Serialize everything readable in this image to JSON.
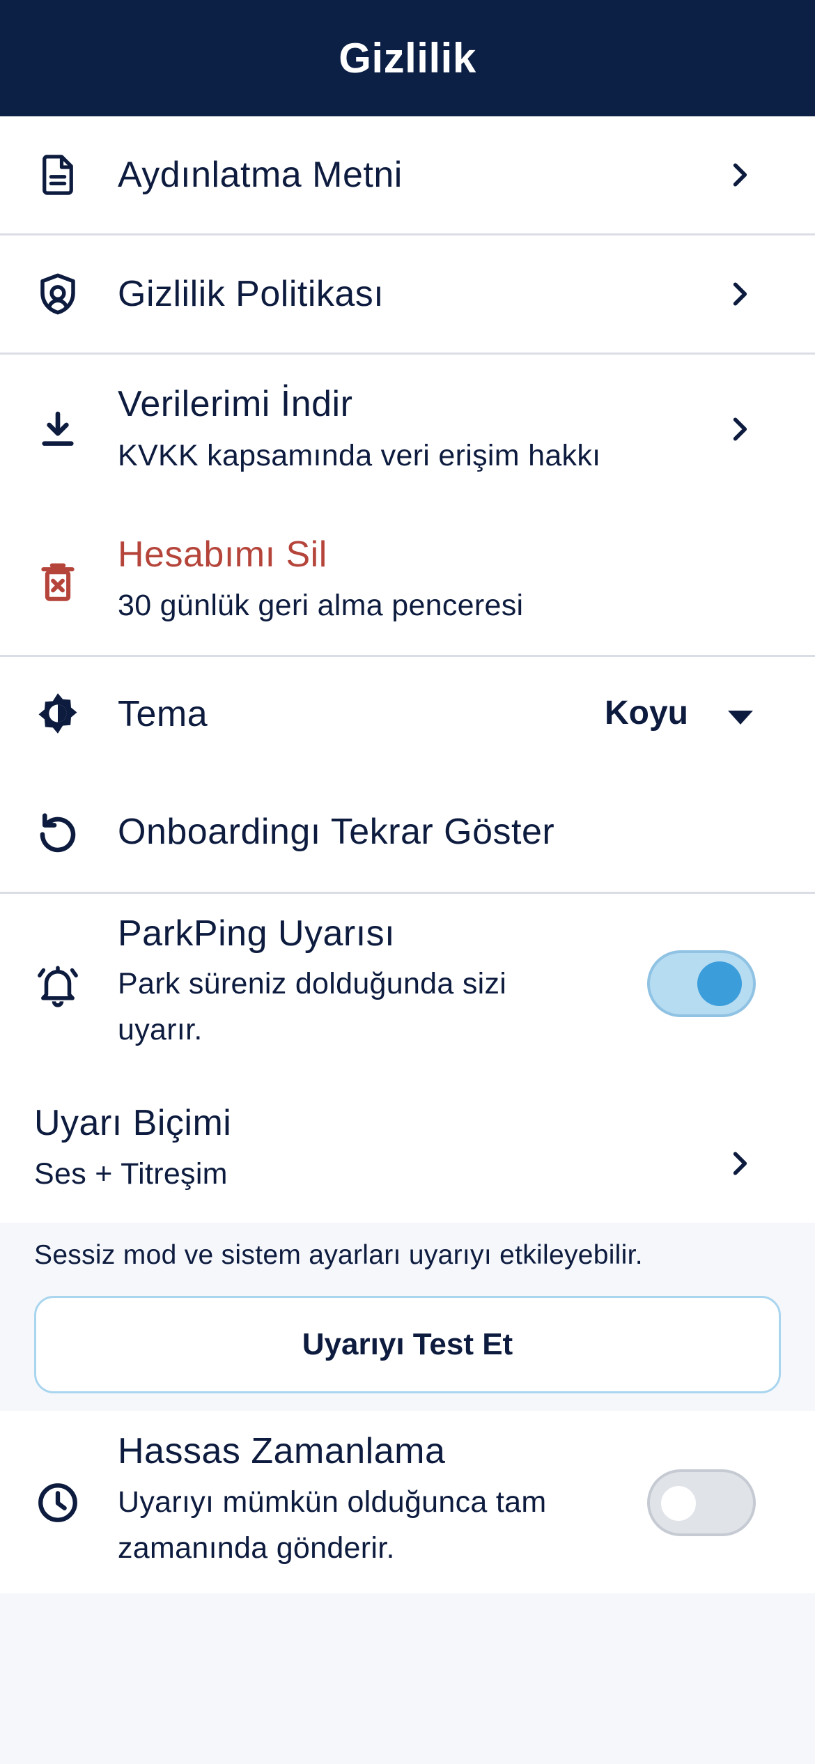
{
  "header": {
    "title": "Gizlilik"
  },
  "menu": {
    "aydinlatma": {
      "label": "Aydınlatma Metni",
      "icon": "document-icon"
    },
    "politika": {
      "label": "Gizlilik Politikası",
      "icon": "shield-icon"
    },
    "indir": {
      "label": "Verilerimi İndir",
      "subtitle": "KVKK kapsamında veri erişim hakkı",
      "icon": "download-icon"
    },
    "sil": {
      "label": "Hesabımı Sil",
      "subtitle": "30 günlük geri alma penceresi",
      "icon": "trash-icon",
      "color": "#b5443a"
    }
  },
  "appearance": {
    "tema": {
      "label": "Tema",
      "value": "Koyu",
      "icon": "theme-icon"
    },
    "onboarding": {
      "label": "Onboardingı Tekrar Göster",
      "icon": "replay-icon"
    }
  },
  "alerts": {
    "parkping": {
      "label": "ParkPing Uyarısı",
      "subtitle": "Park süreniz dolduğunda sizi uyarır.",
      "enabled": true,
      "icon": "bell-icon"
    },
    "bicim": {
      "label": "Uyarı Biçimi",
      "value": "Ses + Titreşim"
    },
    "info": "Sessiz mod ve sistem ayarları uyarıyı etkileyebilir.",
    "test_button": "Uyarıyı Test Et",
    "hassas": {
      "label": "Hassas Zamanlama",
      "subtitle": "Uyarıyı mümkün olduğunca tam zamanında gönderir.",
      "enabled": false,
      "icon": "clock-icon"
    }
  },
  "colors": {
    "header_bg": "#0c1f45",
    "accent": "#3c9ddb",
    "danger": "#b5443a",
    "text": "#0d1b3e"
  }
}
